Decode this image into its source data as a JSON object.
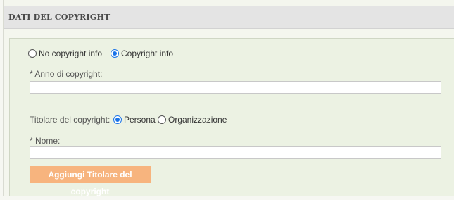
{
  "section": {
    "title": "DATI DEL COPYRIGHT"
  },
  "copyright_option": {
    "no_info_label": "No copyright info",
    "info_label": "Copyright info",
    "selected": "Copyright info"
  },
  "year": {
    "label": "* Anno di copyright:",
    "value": ""
  },
  "holder": {
    "label": "Titolare del copyright:",
    "person_label": "Persona",
    "organization_label": "Organizzazione",
    "selected": "Persona"
  },
  "name": {
    "label": "* Nome:",
    "value": ""
  },
  "add_button": {
    "label": "Aggiungi Titolare del copyright"
  },
  "colors": {
    "accent_radio": "#1a73e8",
    "button_bg": "#f7b47e",
    "panel_bg": "#ecf2e3"
  }
}
